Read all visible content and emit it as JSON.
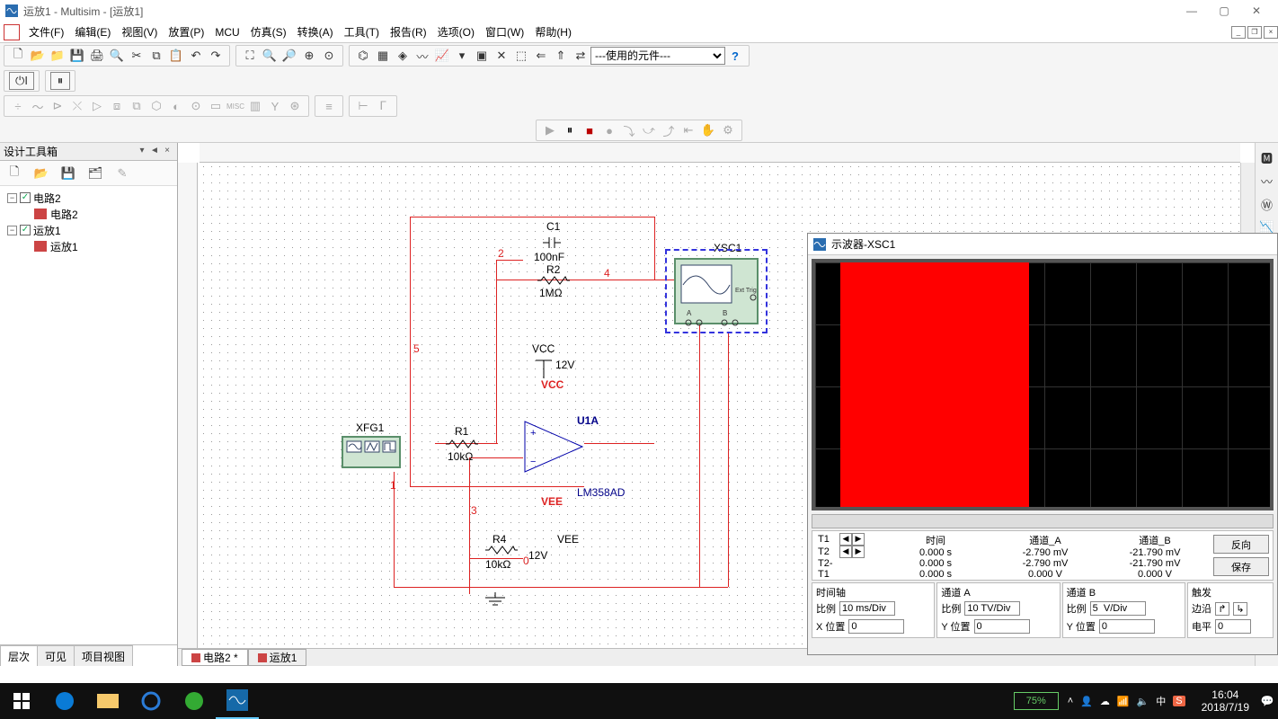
{
  "title": "运放1 - Multisim - [运放1]",
  "menu": [
    "文件(F)",
    "编辑(E)",
    "视图(V)",
    "放置(P)",
    "MCU",
    "仿真(S)",
    "转换(A)",
    "工具(T)",
    "报告(R)",
    "选项(O)",
    "窗口(W)",
    "帮助(H)"
  ],
  "component_dropdown": "---使用的元件---",
  "toolbox": {
    "title": "设计工具箱",
    "items": [
      {
        "label": "电路2",
        "level": 1,
        "expandable": true,
        "checked": true
      },
      {
        "label": "电路2",
        "level": 2,
        "expandable": false
      },
      {
        "label": "运放1",
        "level": 1,
        "expandable": true,
        "checked": true
      },
      {
        "label": "运放1",
        "level": 2,
        "expandable": false
      }
    ],
    "tabs": [
      "层次",
      "可见",
      "项目视图"
    ]
  },
  "doc_tabs": [
    {
      "label": "电路2 *",
      "active": true
    },
    {
      "label": "运放1",
      "active": false
    }
  ],
  "schematic": {
    "C1": {
      "ref": "C1",
      "val": "100nF"
    },
    "R2": {
      "ref": "R2",
      "val": "1MΩ"
    },
    "R1": {
      "ref": "R1",
      "val": "10kΩ"
    },
    "R4": {
      "ref": "R4",
      "val": "10kΩ"
    },
    "VCC": {
      "ref": "VCC",
      "val": "12V",
      "net": "VCC"
    },
    "VEE": {
      "ref": "VEE",
      "val": "12V",
      "net": "VEE"
    },
    "U1A": {
      "ref": "U1A",
      "val": "LM358AD"
    },
    "XFG1": "XFG1",
    "XSC1": "XSC1",
    "nets": {
      "n2": "2",
      "n3": "3",
      "n4": "4",
      "n5": "5",
      "n1": "1",
      "n0": "0"
    },
    "XSC_ext": "Ext Trig",
    "XSC_a": "A",
    "XSC_b": "B"
  },
  "osc": {
    "title": "示波器-XSC1",
    "hdr_time": "时间",
    "hdr_cha": "通道_A",
    "hdr_chb": "通道_B",
    "t1": "T1",
    "t2": "T2",
    "t2t1": "T2-T1",
    "r1": {
      "time": "0.000 s",
      "a": "-2.790 mV",
      "b": "-21.790 mV"
    },
    "r2": {
      "time": "0.000 s",
      "a": "-2.790 mV",
      "b": "-21.790 mV"
    },
    "r3": {
      "time": "0.000 s",
      "a": "0.000 V",
      "b": "0.000 V"
    },
    "btn_rev": "反向",
    "btn_save": "保存",
    "timebase": {
      "title": "时间轴",
      "scale_l": "比例",
      "scale_v": "10 ms/Div",
      "pos_l": "X 位置",
      "pos_v": "0"
    },
    "cha": {
      "title": "通道 A",
      "scale_l": "比例",
      "scale_v": "10 TV/Div",
      "pos_l": "Y 位置",
      "pos_v": "0"
    },
    "chb": {
      "title": "通道 B",
      "scale_l": "比例",
      "scale_v": "5  V/Div",
      "pos_l": "Y 位置",
      "pos_v": "0"
    },
    "trig": {
      "title": "触发",
      "edge_l": "边沿",
      "level_l": "电平",
      "level_v": "0"
    }
  },
  "taskbar": {
    "battery": "75%",
    "time": "16:04",
    "date": "2018/7/19"
  }
}
